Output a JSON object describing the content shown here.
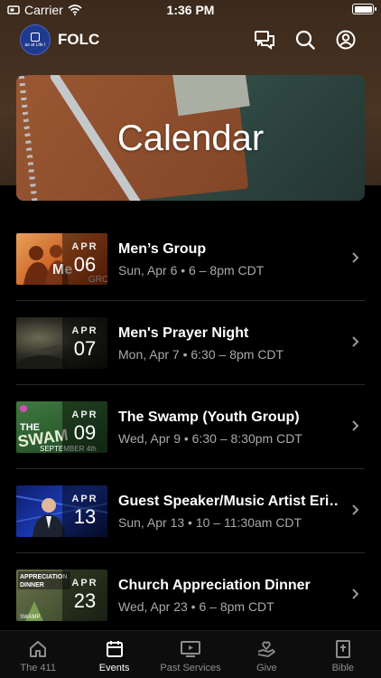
{
  "status_bar": {
    "carrier": "Carrier",
    "time": "1:36 PM"
  },
  "header": {
    "app_name": "FOLC",
    "logo_text": "as at Life I"
  },
  "hero": {
    "title": "Calendar"
  },
  "events": [
    {
      "title": "Men’s Group",
      "meta": "Sun, Apr 6 • 6 – 8pm CDT",
      "month": "APR",
      "day": "06",
      "thumb_theme": "orange"
    },
    {
      "title": "Men's Prayer Night",
      "meta": "Mon, Apr 7 • 6:30 – 8pm CDT",
      "month": "APR",
      "day": "07",
      "thumb_theme": "dark"
    },
    {
      "title": "The Swamp (Youth Group)",
      "meta": "Wed, Apr 9 • 6:30 – 8:30pm CDT",
      "month": "APR",
      "day": "09",
      "thumb_theme": "green"
    },
    {
      "title": "Guest Speaker/Music Artist Eri…",
      "meta": "Sun, Apr 13 • 10 – 11:30am CDT",
      "month": "APR",
      "day": "13",
      "thumb_theme": "blue"
    },
    {
      "title": "Church Appreciation Dinner",
      "meta": "Wed, Apr 23 • 6 – 8pm CDT",
      "month": "APR",
      "day": "23",
      "thumb_theme": "olive"
    }
  ],
  "tabs": [
    {
      "label": "The 411",
      "icon": "home-icon",
      "active": false
    },
    {
      "label": "Events",
      "icon": "calendar-icon",
      "active": true
    },
    {
      "label": "Past Services",
      "icon": "video-icon",
      "active": false
    },
    {
      "label": "Give",
      "icon": "give-icon",
      "active": false
    },
    {
      "label": "Bible",
      "icon": "bible-icon",
      "active": false
    }
  ],
  "colors": {
    "background": "#000000",
    "header_brown": "#4a3422",
    "muted_text": "#a9a9a9",
    "logo_blue": "#1f3a8f"
  }
}
